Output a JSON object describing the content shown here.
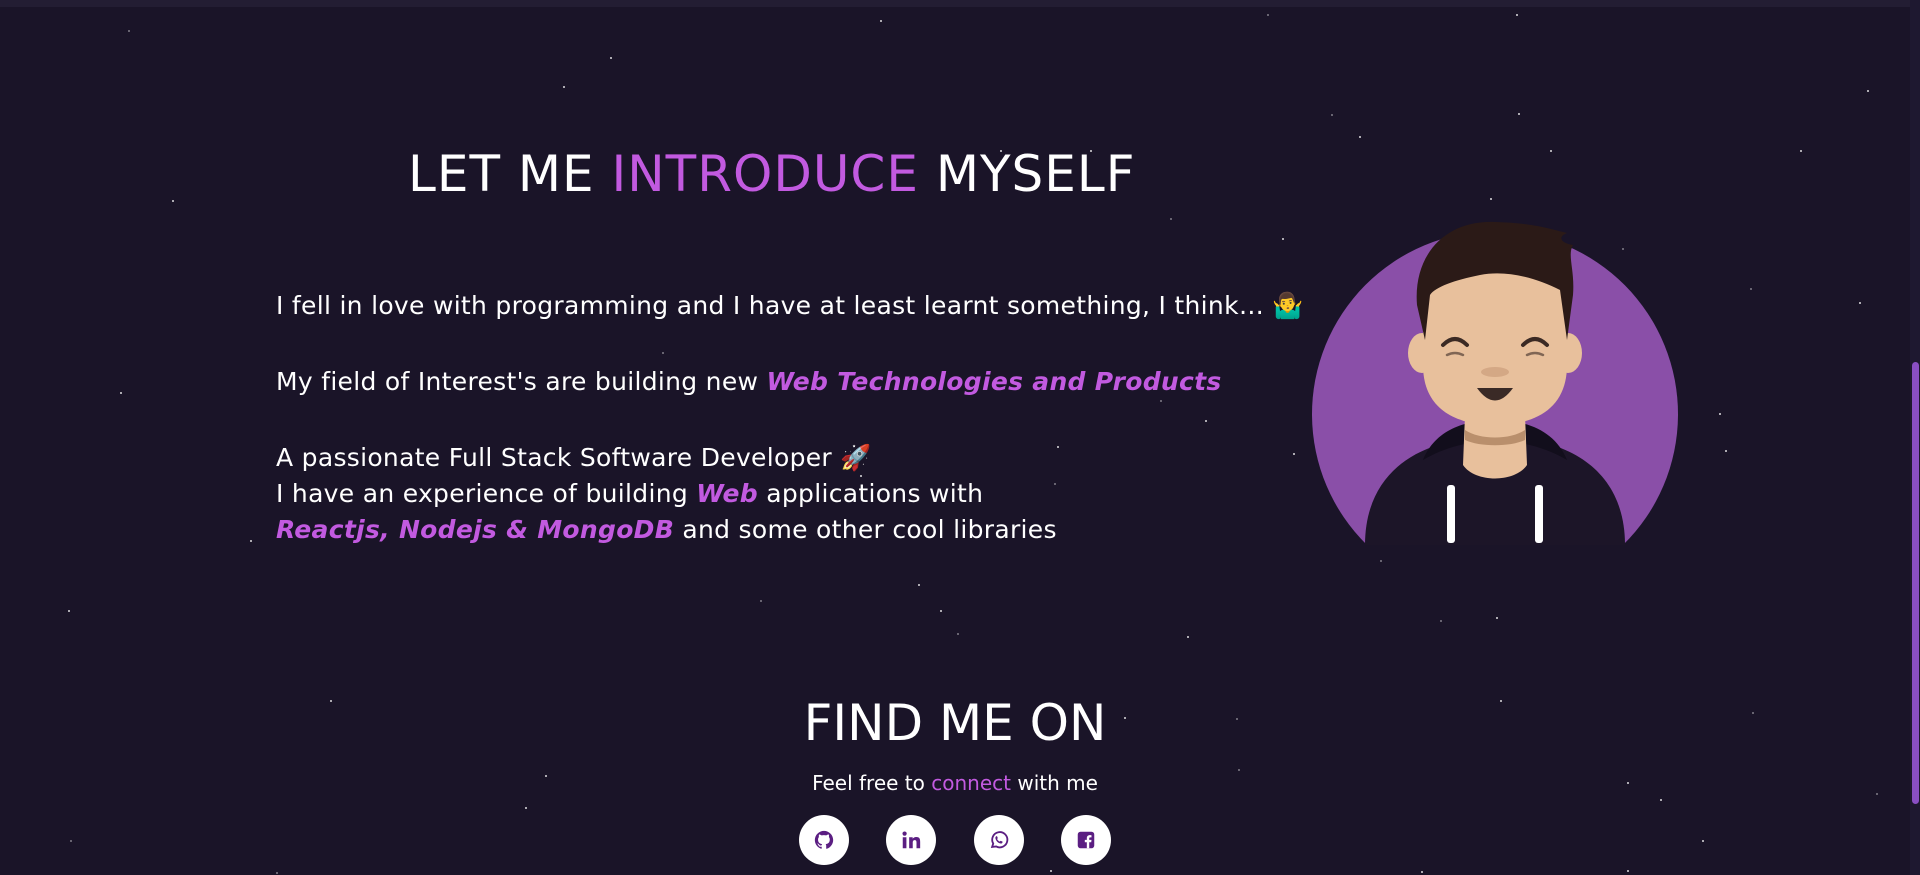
{
  "intro": {
    "title_part1": "LET ME",
    "title_accent": "INTRODUCE",
    "title_part2": "MYSELF",
    "line1": "I fell in love with programming and I have at least learnt something, I think…",
    "line1_emoji": "🤷‍♂️",
    "line2_prefix": "My field of Interest's are building new",
    "line2_highlight": "Web Technologies and Products",
    "line3": "A passionate Full Stack Software Developer",
    "line3_emoji": "🚀",
    "line4_prefix": "I have an experience of building",
    "line4_highlight": "Web",
    "line4_suffix": "applications with",
    "line5_highlight": "Reactjs, Nodejs & MongoDB",
    "line5_suffix": "and some other cool libraries"
  },
  "find": {
    "title": "FIND ME ON",
    "sub_prefix": "Feel free to",
    "sub_accent": "connect",
    "sub_suffix": "with me"
  },
  "socials": [
    {
      "icon": "github-icon"
    },
    {
      "icon": "linkedin-icon"
    },
    {
      "icon": "whatsapp-icon"
    },
    {
      "icon": "facebook-icon"
    }
  ],
  "colors": {
    "background": "#1a1428",
    "accent": "#c25ae0",
    "avatar_circle": "#8a4fa8",
    "icon_purple": "#5b1e82"
  }
}
